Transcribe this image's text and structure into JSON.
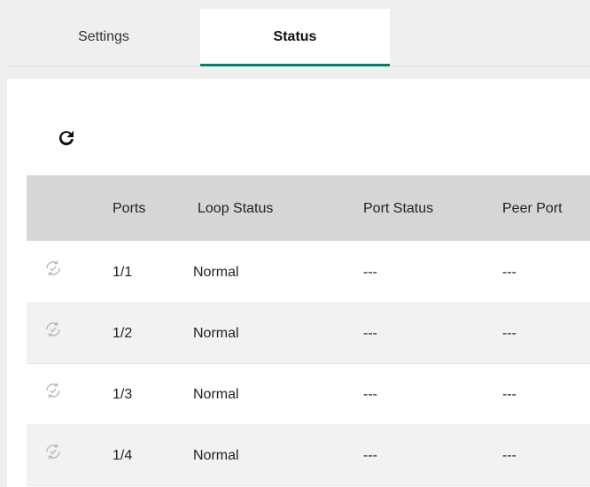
{
  "tabs": [
    {
      "label": "Settings",
      "active": false
    },
    {
      "label": "Status",
      "active": true
    }
  ],
  "toolbar": {
    "refresh_icon": "refresh-icon"
  },
  "table": {
    "headers": [
      "",
      "Ports",
      "Loop Status",
      "Port Status",
      "Peer Port"
    ],
    "rows": [
      {
        "icon": "loop-check-icon",
        "port": "1/1",
        "loop_status": "Normal",
        "port_status": "---",
        "peer_port": "---"
      },
      {
        "icon": "loop-check-icon",
        "port": "1/2",
        "loop_status": "Normal",
        "port_status": "---",
        "peer_port": "---"
      },
      {
        "icon": "loop-check-icon",
        "port": "1/3",
        "loop_status": "Normal",
        "port_status": "---",
        "peer_port": "---"
      },
      {
        "icon": "loop-check-icon",
        "port": "1/4",
        "loop_status": "Normal",
        "port_status": "---",
        "peer_port": "---"
      }
    ]
  },
  "colors": {
    "accent": "#0f7a6c",
    "header_bg": "#d6d6d6",
    "alt_row": "#f2f2f2"
  }
}
